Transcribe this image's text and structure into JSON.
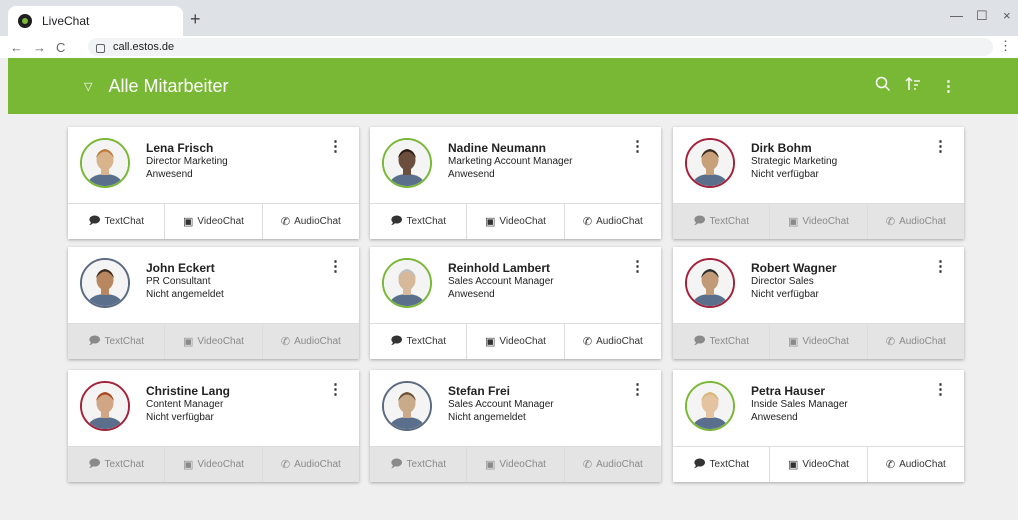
{
  "browser": {
    "tab_title": "LiveChat",
    "new_tab": "+",
    "url": "call.estos.de",
    "back": "←",
    "forward": "→",
    "reload": "C"
  },
  "app": {
    "title": "Alle Mitarbeiter",
    "accent_color": "#78b834"
  },
  "actions": {
    "text": "TextChat",
    "video": "VideoChat",
    "audio": "AudioChat"
  },
  "contacts": [
    {
      "name": "Lena Frisch",
      "role": "Director Marketing",
      "status": "Anwesend"
    },
    {
      "name": "Nadine Neumann",
      "role": "Marketing Account Manager",
      "status": "Anwesend"
    },
    {
      "name": "Dirk Bohm",
      "role": "Strategic Marketing",
      "status": "Nicht verfügbar"
    },
    {
      "name": "John Eckert",
      "role": "PR Consultant",
      "status": "Nicht angemeldet"
    },
    {
      "name": "Reinhold Lambert",
      "role": "Sales Account Manager",
      "status": "Anwesend"
    },
    {
      "name": "Robert Wagner",
      "role": "Director Sales",
      "status": "Nicht verfügbar"
    },
    {
      "name": "Christine Lang",
      "role": "Content Manager",
      "status": "Nicht verfügbar"
    },
    {
      "name": "Stefan Frei",
      "role": "Sales Account Manager",
      "status": "Nicht angemeldet"
    },
    {
      "name": "Petra Hauser",
      "role": "Inside Sales Manager",
      "status": "Anwesend"
    }
  ]
}
